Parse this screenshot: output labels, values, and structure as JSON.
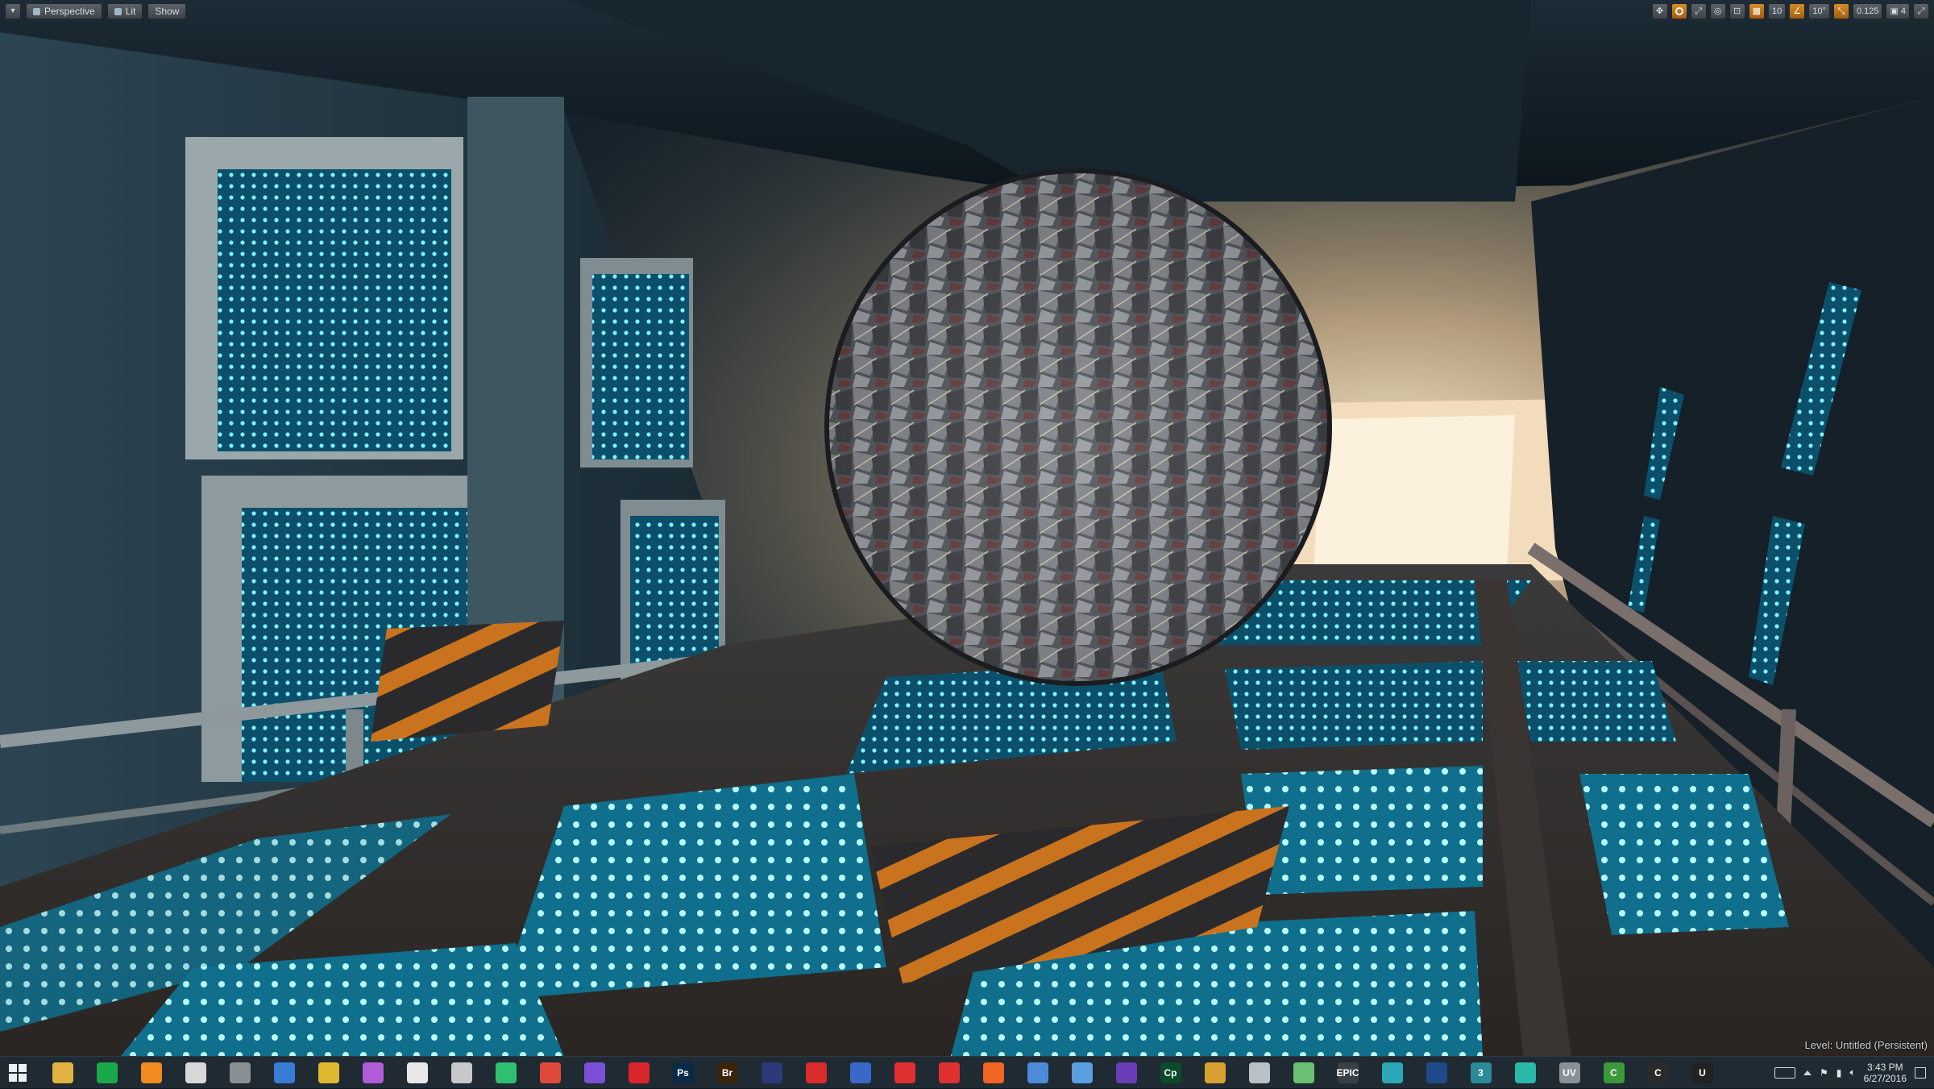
{
  "viewport": {
    "menu_icon": "chevron-down-icon",
    "buttons": [
      "Perspective",
      "Lit",
      "Show"
    ],
    "right_toolbar": {
      "grid_snap_value": "10",
      "rotation_snap_value": "10°",
      "scale_snap_value": "0.125",
      "camera_speed_value": "4"
    },
    "level_label": "Level:  Untitled (Persistent)"
  },
  "taskbar": {
    "apps": [
      {
        "icon": "file-explorer-icon",
        "label": "",
        "color": "#e3b341"
      },
      {
        "icon": "store-icon",
        "label": "",
        "color": "#1ba84a"
      },
      {
        "icon": "blender-icon",
        "label": "",
        "color": "#f08b1e"
      },
      {
        "icon": "unity-icon",
        "label": "",
        "color": "#d8d8d8"
      },
      {
        "icon": "app-icon",
        "label": "",
        "color": "#8a8f94"
      },
      {
        "icon": "app-icon",
        "label": "",
        "color": "#3a7bd5"
      },
      {
        "icon": "ruler-icon",
        "label": "",
        "color": "#e0b830"
      },
      {
        "icon": "app-icon",
        "label": "",
        "color": "#b05cd8"
      },
      {
        "icon": "figure-icon",
        "label": "",
        "color": "#e8e8e8"
      },
      {
        "icon": "app-icon",
        "label": "",
        "color": "#c8c8c8"
      },
      {
        "icon": "headphones-icon",
        "label": "",
        "color": "#2fbf71"
      },
      {
        "icon": "chrome-icon",
        "label": "",
        "color": "#e04a3a"
      },
      {
        "icon": "app-icon",
        "label": "",
        "color": "#7b4fd6"
      },
      {
        "icon": "creative-cloud-icon",
        "label": "",
        "color": "#d9262b"
      },
      {
        "icon": "photoshop-icon",
        "label": "Ps",
        "color": "#0a2a4a"
      },
      {
        "icon": "bridge-icon",
        "label": "Br",
        "color": "#3a2308"
      },
      {
        "icon": "cinema4d-icon",
        "label": "",
        "color": "#2c3a7a"
      },
      {
        "icon": "app-icon",
        "label": "",
        "color": "#d92c2c"
      },
      {
        "icon": "app-icon",
        "label": "",
        "color": "#3a68c8"
      },
      {
        "icon": "app-icon",
        "label": "",
        "color": "#e03030"
      },
      {
        "icon": "app-icon",
        "label": "",
        "color": "#e03030"
      },
      {
        "icon": "firefox-icon",
        "label": "",
        "color": "#f26522"
      },
      {
        "icon": "app-icon",
        "label": "",
        "color": "#4d8bd8"
      },
      {
        "icon": "app-icon",
        "label": "",
        "color": "#5aa0e0"
      },
      {
        "icon": "app-icon",
        "label": "",
        "color": "#6a3db8"
      },
      {
        "icon": "captivate-icon",
        "label": "Cp",
        "color": "#0b4a2a"
      },
      {
        "icon": "app-icon",
        "label": "",
        "color": "#d8a030"
      },
      {
        "icon": "app-icon",
        "label": "",
        "color": "#b8c0c8"
      },
      {
        "icon": "app-icon",
        "label": "",
        "color": "#6ac070"
      },
      {
        "icon": "epic-launcher-icon",
        "label": "EPIC",
        "color": "#3a3f44"
      },
      {
        "icon": "app-icon",
        "label": "",
        "color": "#2aa8b8"
      },
      {
        "icon": "app-icon",
        "label": "",
        "color": "#1e4a8a"
      },
      {
        "icon": "app-icon",
        "label": "3",
        "color": "#2a8a9a"
      },
      {
        "icon": "app-icon",
        "label": "",
        "color": "#2ab8a8"
      },
      {
        "icon": "uv-icon",
        "label": "UV",
        "color": "#8a9098"
      },
      {
        "icon": "app-icon",
        "label": "C",
        "color": "#3a9a3a"
      },
      {
        "icon": "app-icon",
        "label": "C",
        "color": "#2a2a2a"
      },
      {
        "icon": "unreal-engine-icon",
        "label": "U",
        "color": "#222222"
      }
    ],
    "clock_time": "3:43 PM",
    "clock_date": "6/27/2016"
  }
}
